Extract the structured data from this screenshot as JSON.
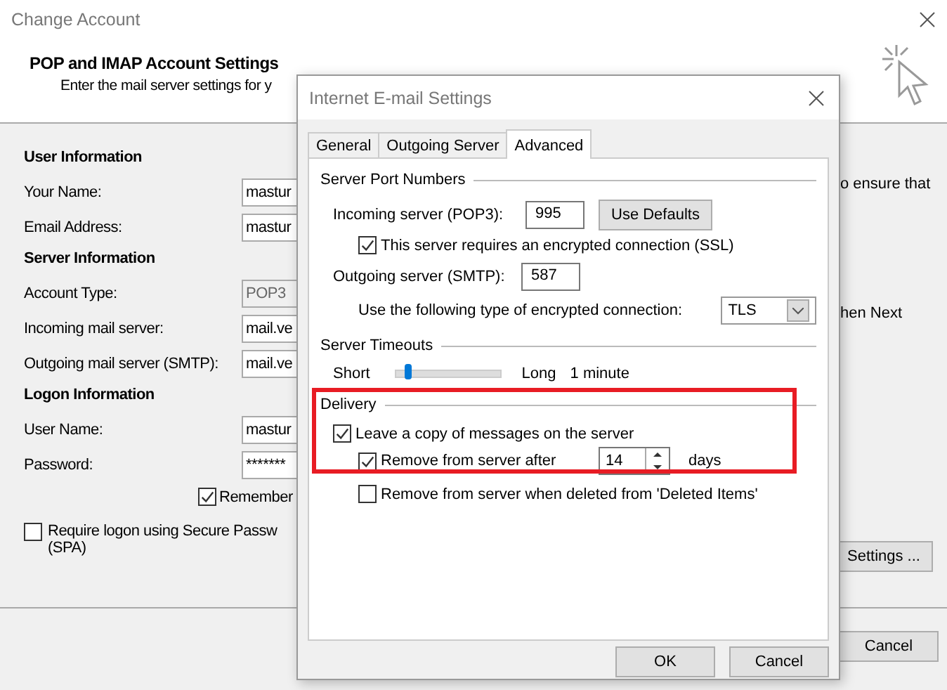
{
  "window": {
    "title": "Change Account",
    "header_title": "POP and IMAP Account Settings",
    "header_subtitle": "Enter the mail server settings for y"
  },
  "sections": [
    {
      "heading": "User Information",
      "fields": [
        {
          "label": "Your Name:",
          "value": "mastur",
          "disabled": false
        },
        {
          "label": "Email Address:",
          "value": "mastur",
          "disabled": false
        }
      ]
    },
    {
      "heading": "Server Information",
      "fields": [
        {
          "label": "Account Type:",
          "value": "POP3",
          "disabled": true
        },
        {
          "label": "Incoming mail server:",
          "value": "mail.ve",
          "disabled": false
        },
        {
          "label": "Outgoing mail server (SMTP):",
          "value": "mail.ve",
          "disabled": false
        }
      ]
    },
    {
      "heading": "Logon Information",
      "fields": [
        {
          "label": "User Name:",
          "value": "mastur",
          "disabled": false
        },
        {
          "label": "Password:",
          "value": "*******",
          "disabled": false
        }
      ]
    }
  ],
  "remember_password": {
    "label": "Remember",
    "checked": true
  },
  "spa": {
    "lines": [
      "Require logon using Secure Passw",
      "(SPA)"
    ],
    "checked": false
  },
  "right_texts": [
    "o ensure that",
    "hen Next"
  ],
  "more_settings_button": "Settings ...",
  "footer_buttons": [
    "Cancel"
  ],
  "dialog": {
    "title": "Internet E-mail Settings",
    "tabs": [
      {
        "label": "General",
        "selected": false
      },
      {
        "label": "Outgoing Server",
        "selected": false
      },
      {
        "label": "Advanced",
        "selected": true
      }
    ],
    "ports": {
      "title": "Server Port Numbers",
      "incoming_label": "Incoming server (POP3):",
      "incoming_value": "995",
      "defaults_button": "Use Defaults",
      "ssl": {
        "label": "This server requires an encrypted connection (SSL)",
        "checked": true
      },
      "outgoing_label": "Outgoing server (SMTP):",
      "outgoing_value": "587",
      "encryption_label": "Use the following type of encrypted connection:",
      "encryption_value": "TLS"
    },
    "timeouts": {
      "title": "Server Timeouts",
      "short_label": "Short",
      "long_label": "Long",
      "level": 0.1,
      "reading": "1 minute"
    },
    "delivery": {
      "title": "Delivery",
      "leave_copy": {
        "label": "Leave a copy of messages on the server",
        "checked": true
      },
      "remove_after": {
        "label": "Remove from server after",
        "checked": true,
        "value": "14",
        "unit": "days"
      },
      "remove_deleted": {
        "label": "Remove from server when deleted from 'Deleted Items'",
        "checked": false
      }
    },
    "buttons": [
      "OK",
      "Cancel"
    ]
  }
}
